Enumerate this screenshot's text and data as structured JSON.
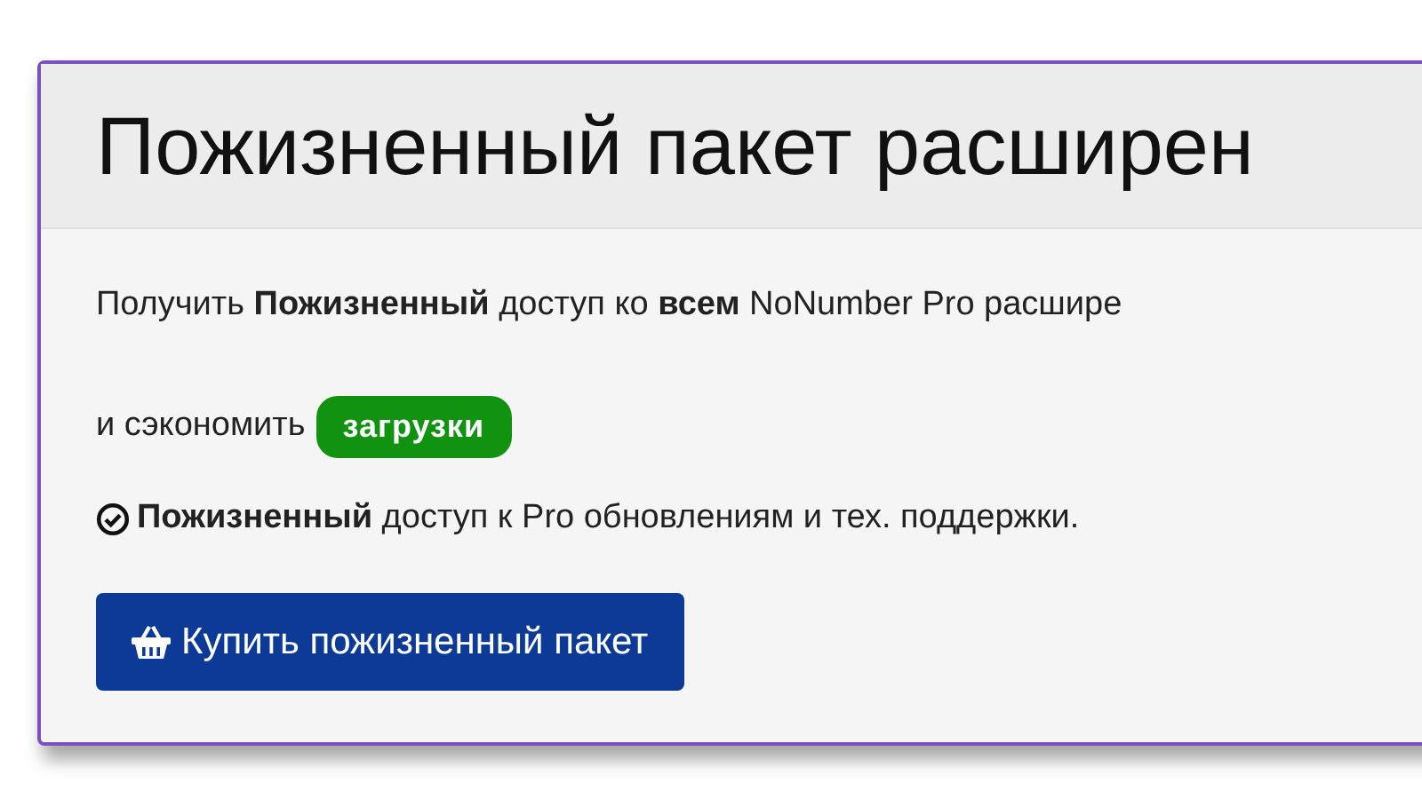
{
  "card": {
    "title": "Пожизненный пакет расширен",
    "intro": "Получить **Пожизненный** доступ ко **всем** NoNumber Pro расшире",
    "save_text": "и сэкономить",
    "badge": "загрузки",
    "feature": "**Пожизненный** доступ к Pro обновлениям и тех. поддержки.",
    "button": "Купить пожизненный пакет"
  }
}
